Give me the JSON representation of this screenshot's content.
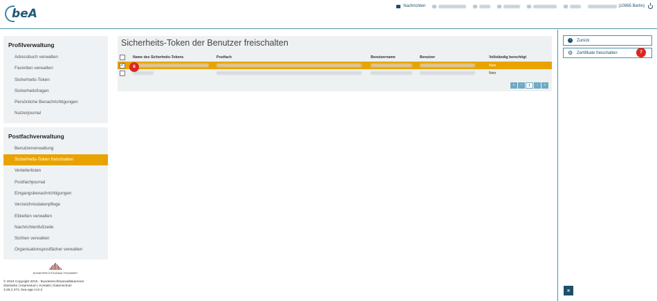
{
  "header": {
    "logo_text": "beA",
    "logo_subtitle": "",
    "messages_label": "Nachrichten",
    "location_label": "(10965 Berlin)"
  },
  "sidebar": {
    "profile": {
      "title": "Profilverwaltung",
      "items": [
        "Adressbuch verwalten",
        "Favoriten verwalten",
        "Sicherheits-Token",
        "Sicherheitsfragen",
        "Persönliche Benachrichtigungen",
        "Nutzerjournal"
      ]
    },
    "postfach": {
      "title": "Postfachverwaltung",
      "items": [
        "Benutzerverwaltung",
        "Sicherheits-Token freischalten",
        "Verteilerlisten",
        "Postfachjournal",
        "Eingangsbenachrichtigungen",
        "Verzeichnisdatenpflege",
        "Etiketten verwalten",
        "Nachrichtenfußzeile",
        "Sichten verwalten",
        "Organisationspostfächer verwalten"
      ],
      "active_index": 1
    },
    "footer": {
      "org_name": "BUNDESRECHTSANWALTSKAMMER",
      "copyright": "© 2024 Copyright 2015 - Bundesrechtsanwaltskammer",
      "links": "Startseite | Impressum | Kontakt | Datenschutz",
      "version": "3.28.2.373, bea-app-cc2-2"
    }
  },
  "main": {
    "title": "Sicherheits-Token der Benutzer freischalten",
    "columns": {
      "name": "Name des Sicherheits-Tokens",
      "postfach": "Postfach",
      "benutzername": "Benutzername",
      "benutzer": "Benutzer",
      "berechtigt": "Vollständig berechtigt"
    },
    "rows": [
      {
        "checked": true,
        "selected": true,
        "berechtigt": "Nein"
      },
      {
        "checked": false,
        "selected": false,
        "berechtigt": "Nein"
      }
    ],
    "pager": {
      "first": "«",
      "prev": "‹",
      "page": "1",
      "next": "›",
      "last": "»"
    },
    "badge_row": "6"
  },
  "rail": {
    "back_label": "Zurück",
    "unlock_label": "Zertifikate freischalten",
    "badge": "7",
    "expand_label": "»"
  },
  "icons": {
    "back": "arrow-left-circle-icon",
    "unlock": "gear-icon",
    "messages": "envelope-icon",
    "logout": "power-icon"
  },
  "colors": {
    "accent": "#e8a300",
    "primary": "#1d4f6b",
    "badge": "#d9281f",
    "panel": "#eef2f4"
  }
}
